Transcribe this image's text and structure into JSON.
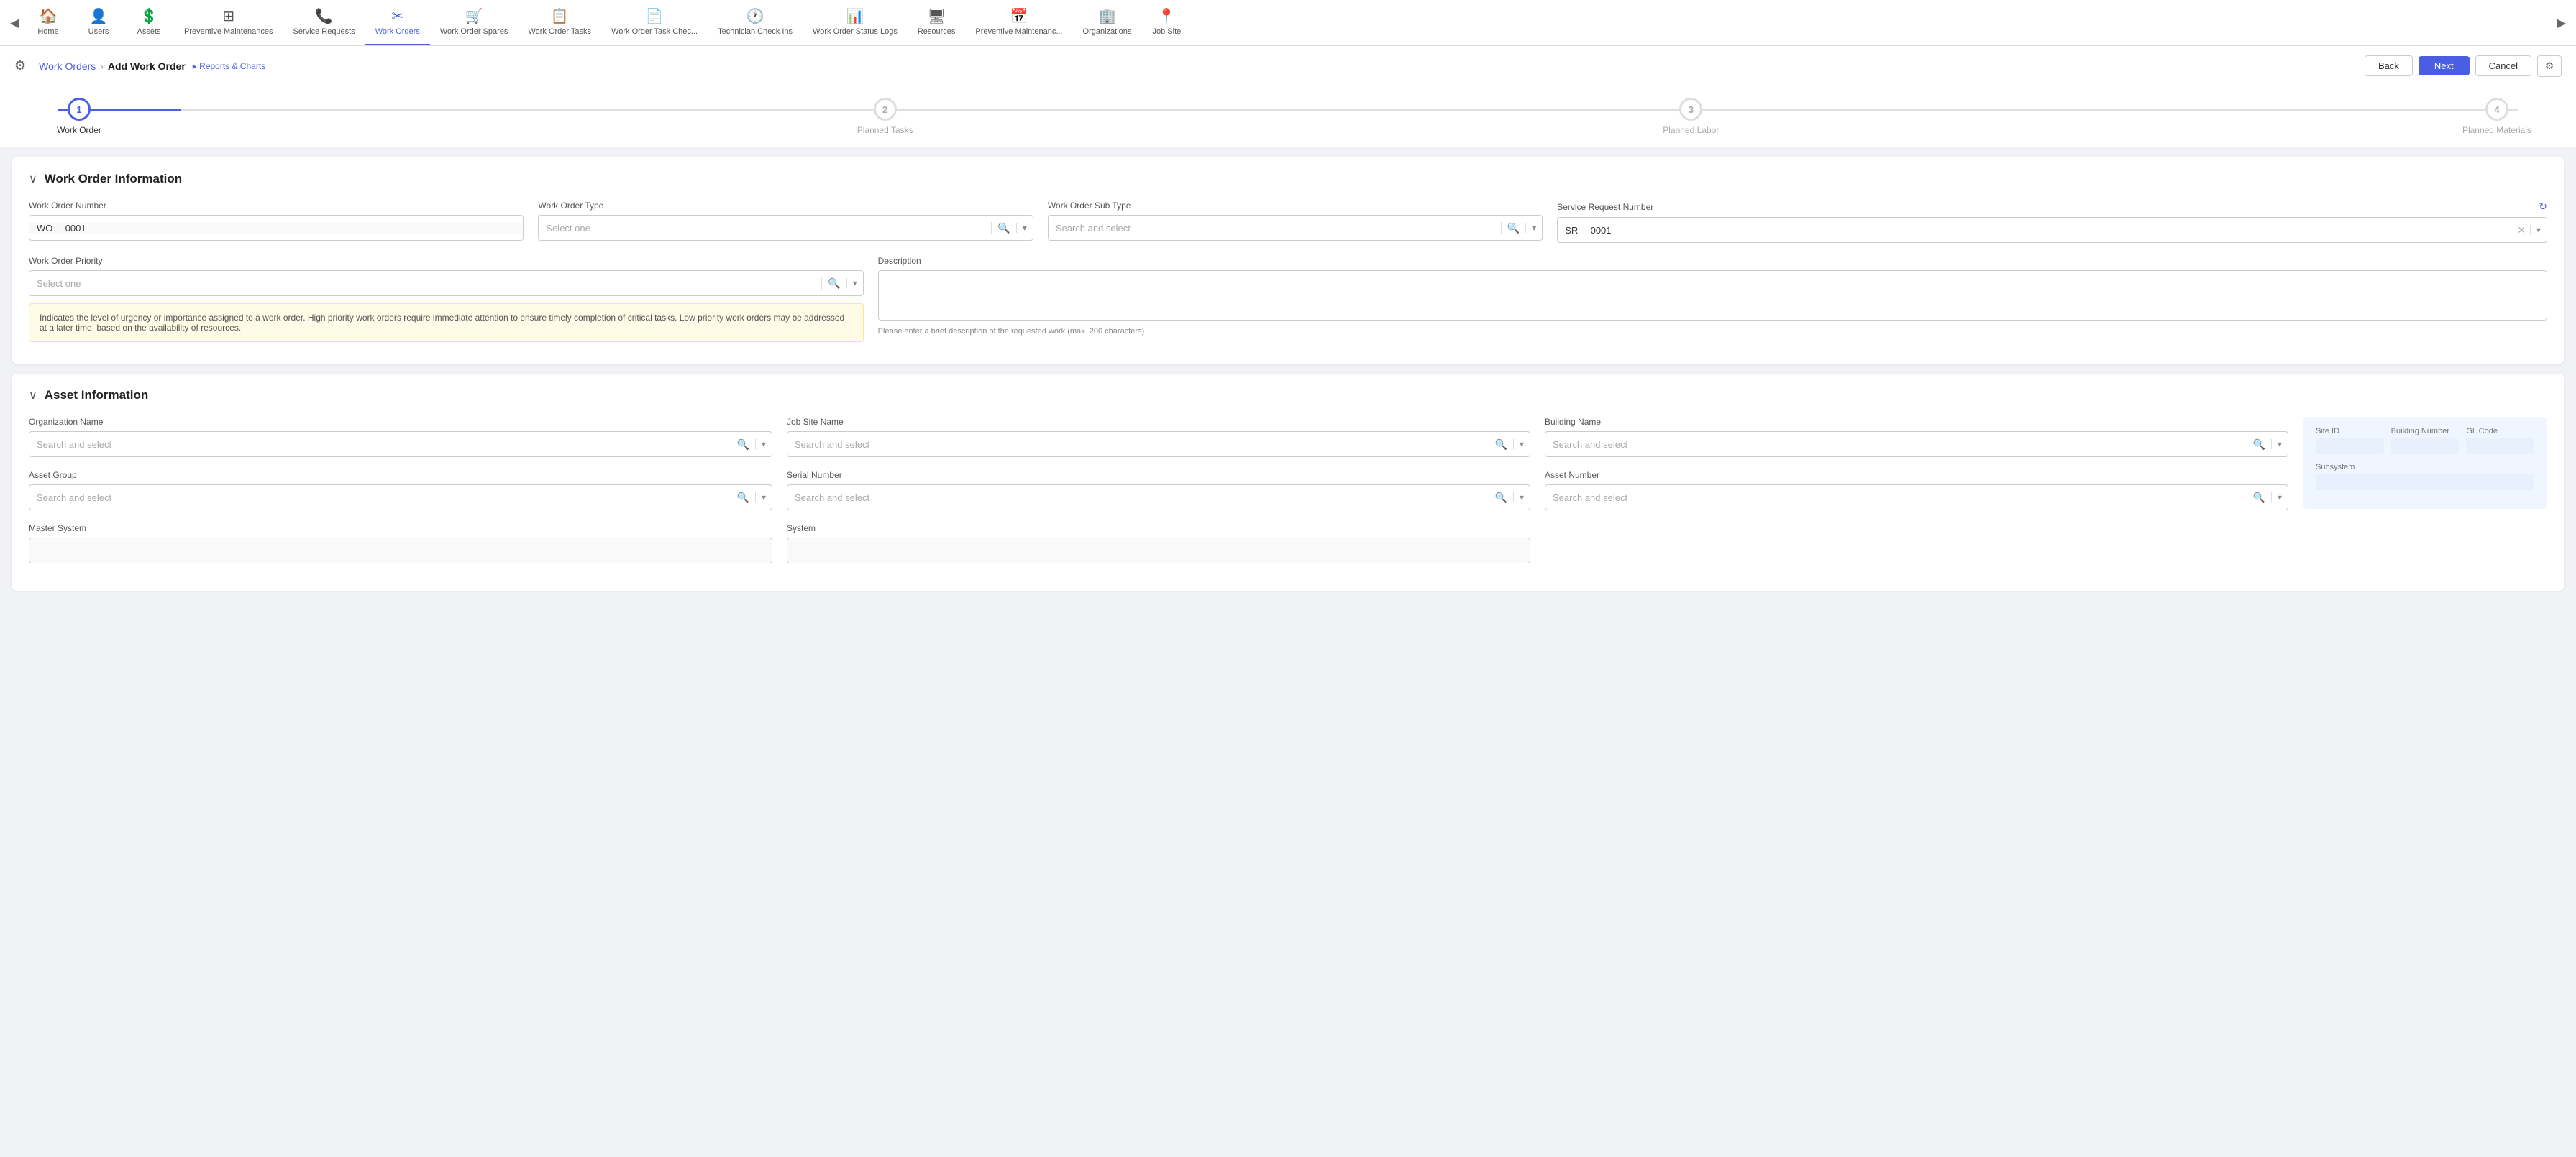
{
  "nav": {
    "prev_icon": "◀",
    "next_icon": "▶",
    "items": [
      {
        "id": "home",
        "icon": "🏠",
        "label": "Home",
        "active": false
      },
      {
        "id": "users",
        "icon": "👤",
        "label": "Users",
        "active": false
      },
      {
        "id": "assets",
        "icon": "💲",
        "label": "Assets",
        "active": false
      },
      {
        "id": "preventive-maintenances",
        "icon": "⊞",
        "label": "Preventive Maintenances",
        "active": false
      },
      {
        "id": "service-requests",
        "icon": "📞",
        "label": "Service Requests",
        "active": false
      },
      {
        "id": "work-orders",
        "icon": "✂",
        "label": "Work Orders",
        "active": true
      },
      {
        "id": "work-order-spares",
        "icon": "🛒",
        "label": "Work Order Spares",
        "active": false
      },
      {
        "id": "work-order-tasks",
        "icon": "📋",
        "label": "Work Order Tasks",
        "active": false
      },
      {
        "id": "work-order-task-check",
        "icon": "📄",
        "label": "Work Order Task Chec...",
        "active": false
      },
      {
        "id": "technician-check-ins",
        "icon": "🕐",
        "label": "Technician Check Ins",
        "active": false
      },
      {
        "id": "work-order-status-logs",
        "icon": "📊",
        "label": "Work Order Status Logs",
        "active": false
      },
      {
        "id": "resources",
        "icon": "🖥",
        "label": "Resources",
        "active": false
      },
      {
        "id": "preventive-maintenances-2",
        "icon": "📅",
        "label": "Preventive Maintenanc...",
        "active": false
      },
      {
        "id": "organizations",
        "icon": "🏢",
        "label": "Organizations",
        "active": false
      },
      {
        "id": "job-site",
        "icon": "📍",
        "label": "Job Site",
        "active": false
      }
    ]
  },
  "toolbar": {
    "settings_icon": "⚙",
    "breadcrumb_parent": "Work Orders",
    "breadcrumb_sep": "›",
    "breadcrumb_current": "Add Work Order",
    "breadcrumb_sub_icon": "▶",
    "breadcrumb_sub_label": "Reports & Charts",
    "back_label": "Back",
    "next_label": "Next",
    "cancel_label": "Cancel",
    "filter_icon": "⚙"
  },
  "steps": [
    {
      "number": "1",
      "label": "Work Order",
      "active": true
    },
    {
      "number": "2",
      "label": "Planned Tasks",
      "active": false
    },
    {
      "number": "3",
      "label": "Planned Labor",
      "active": false
    },
    {
      "number": "4",
      "label": "Planned Materials",
      "active": false
    }
  ],
  "work_order_section": {
    "title": "Work Order Information",
    "toggle_icon": "∨",
    "fields": {
      "work_order_number_label": "Work Order Number",
      "work_order_number_value": "WO----0001",
      "work_order_type_label": "Work Order Type",
      "work_order_type_placeholder": "Select one",
      "work_order_sub_type_label": "Work Order Sub Type",
      "work_order_sub_type_placeholder": "Search and select",
      "service_request_number_label": "Service Request Number",
      "service_request_number_value": "SR----0001",
      "work_order_priority_label": "Work Order Priority",
      "work_order_priority_placeholder": "Select one",
      "description_label": "Description",
      "description_hint": "Please enter a brief description of the requested work (max. 200 characters)",
      "priority_warning": "Indicates the level of urgency or importance assigned to a work order. High priority work orders require immediate attention to ensure timely completion of critical tasks. Low priority work orders may be addressed at a later time, based on the availability of resources."
    }
  },
  "asset_section": {
    "title": "Asset Information",
    "toggle_icon": "∨",
    "fields": {
      "org_name_label": "Organization Name",
      "org_name_placeholder": "Search and select",
      "job_site_name_label": "Job Site Name",
      "job_site_name_placeholder": "Search and select",
      "building_name_label": "Building Name",
      "building_name_placeholder": "Search and select",
      "site_id_label": "Site ID",
      "building_number_label": "Building Number",
      "gl_code_label": "GL Code",
      "subsystem_label": "Subsystem",
      "asset_group_label": "Asset Group",
      "asset_group_placeholder": "Search and select",
      "serial_number_label": "Serial Number",
      "serial_number_placeholder": "Search and select",
      "asset_number_label": "Asset Number",
      "asset_number_placeholder": "Search and select",
      "master_system_label": "Master System",
      "system_label": "System"
    }
  },
  "icons": {
    "search": "🔍",
    "dropdown": "▾",
    "clear": "✕",
    "refresh": "↻",
    "chevron_down": "▾",
    "chevron_right": "▸"
  }
}
